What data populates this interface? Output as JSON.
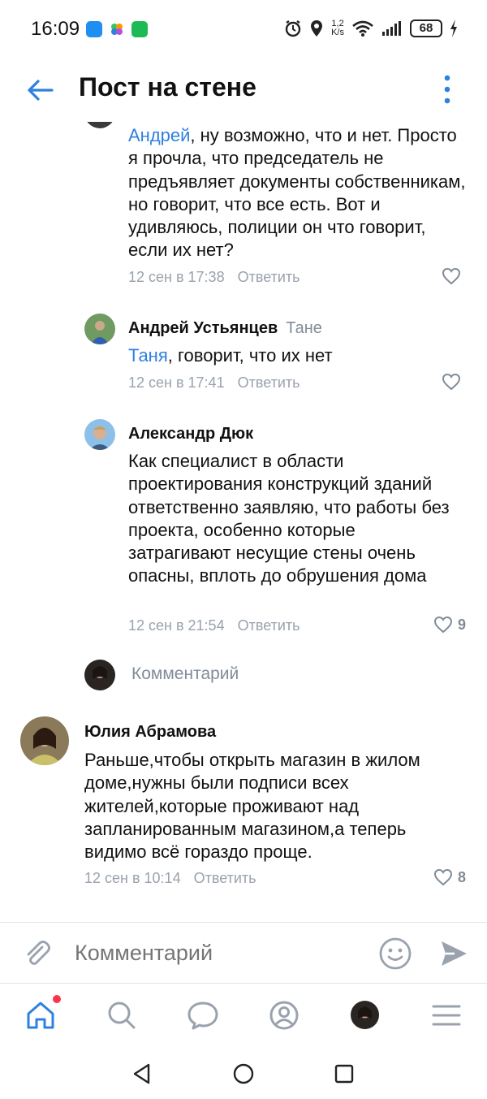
{
  "status_bar": {
    "time": "16:09",
    "net_speed_value": "1,2",
    "net_speed_unit": "K/s",
    "battery": "68"
  },
  "app_bar": {
    "title": "Пост на стене"
  },
  "comments": [
    {
      "mention": "Андрей",
      "text": ", ну возможно, что и нет. Просто я прочла, что председатель не предъявляет документы собственникам, но говорит, что все есть. Вот и удивляюсь, полиции он что говорит, если их нет?",
      "date": "12 сен в 17:38",
      "reply_label": "Ответить",
      "likes": ""
    },
    {
      "author": "Андрей Устьянцев",
      "reply_to": "Тане",
      "mention": "Таня",
      "text": ", говорит, что их нет",
      "date": "12 сен в 17:41",
      "reply_label": "Ответить",
      "likes": ""
    },
    {
      "author": "Александр Дюк",
      "text": "Как специалист в области проектирования конструкций зданий ответственно заявляю, что работы без проекта, особенно которые затрагивают несущие стены очень опасны, вплоть до обрушения дома",
      "date": "12 сен в 21:54",
      "reply_label": "Ответить",
      "likes": "9"
    },
    {
      "author": "Юлия Абрамова",
      "text": "Раньше,чтобы открыть магазин в жилом доме,нужны были подписи всех жителей,которые проживают над запланированным магазином,а теперь видимо всё гораздо проще.",
      "date": "12 сен в 10:14",
      "reply_label": "Ответить",
      "likes": "8"
    }
  ],
  "reply_box": {
    "placeholder": "Комментарий"
  },
  "input_bar": {
    "placeholder": "Комментарий"
  },
  "colors": {
    "accent": "#2d81e0",
    "secondary_text": "#818c99",
    "notification": "#ff3347"
  }
}
